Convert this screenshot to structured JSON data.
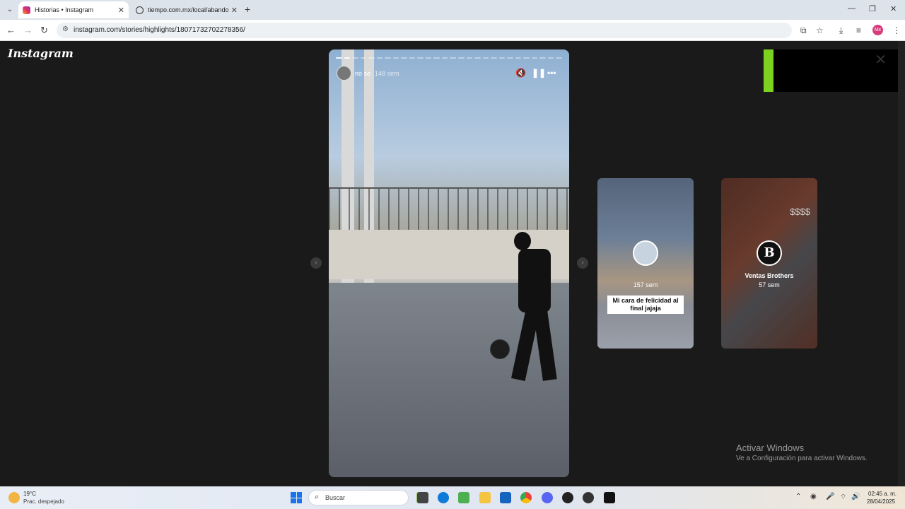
{
  "browser": {
    "tabs": [
      {
        "title": "Historias • Instagram",
        "favicon": "instagram-icon",
        "active": true
      },
      {
        "title": "tiempo.com.mx/local/abandon",
        "favicon": "globe-icon",
        "active": false
      }
    ],
    "url": "instagram.com/stories/highlights/18071732702278356/",
    "profile_initials": "Mx"
  },
  "instagram": {
    "logo": "Instagram",
    "story": {
      "username": "no se",
      "age": "148 sem"
    },
    "previews": [
      {
        "age": "157 sem",
        "caption_line1": "Mi cara de felicidad al",
        "caption_line2": "final jajaja"
      },
      {
        "name": "Ventas Brothers",
        "age": "57 sem",
        "overlay_text": "$$$$",
        "avatar_letter": "B"
      }
    ]
  },
  "watermark": {
    "title": "Activar Windows",
    "subtitle": "Ve a Configuración para activar Windows."
  },
  "taskbar": {
    "temperature": "19°C",
    "condition": "Prac. despejado",
    "search_label": "Buscar",
    "time": "02:45 a. m.",
    "date": "28/04/2025"
  },
  "colors": {
    "instagram_bg": "#1a1a1a",
    "accent_green": "#7bd320",
    "windows_blue": "#1a73e8"
  }
}
